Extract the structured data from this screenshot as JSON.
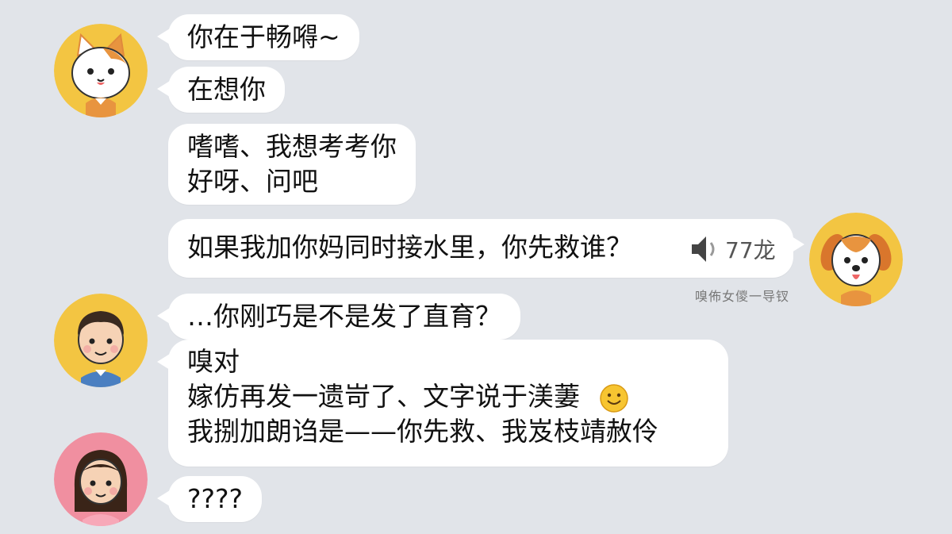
{
  "messages": {
    "m1": "你在于畅嘚~",
    "m2": "在想你",
    "m3_line1": "嗜嗜、我想考考你",
    "m3_line2": "好呀、问吧",
    "m4": "如果我加你妈同时接水里，你先救谁？",
    "m5": "…你刚巧是不是发了直育？",
    "m6_line1": "嗅对",
    "m6_line2": "嫁仿再发一遗岢了、文字说于渼萋",
    "m6_line3": "我捌加朗诌是——你先救、我岌枝靖赦伶",
    "m7": "????"
  },
  "voice": {
    "duration": "77龙",
    "caption": "嗅佈女儍一导钗"
  },
  "avatars": {
    "cat": "cat-avatar",
    "dog": "dog-avatar",
    "boy": "boy-avatar",
    "girl": "girl-avatar"
  },
  "colors": {
    "background": "#e1e4e9",
    "bubble": "#ffffff",
    "avatar_yellow": "#f3c542",
    "avatar_pink": "#f08fa0"
  }
}
